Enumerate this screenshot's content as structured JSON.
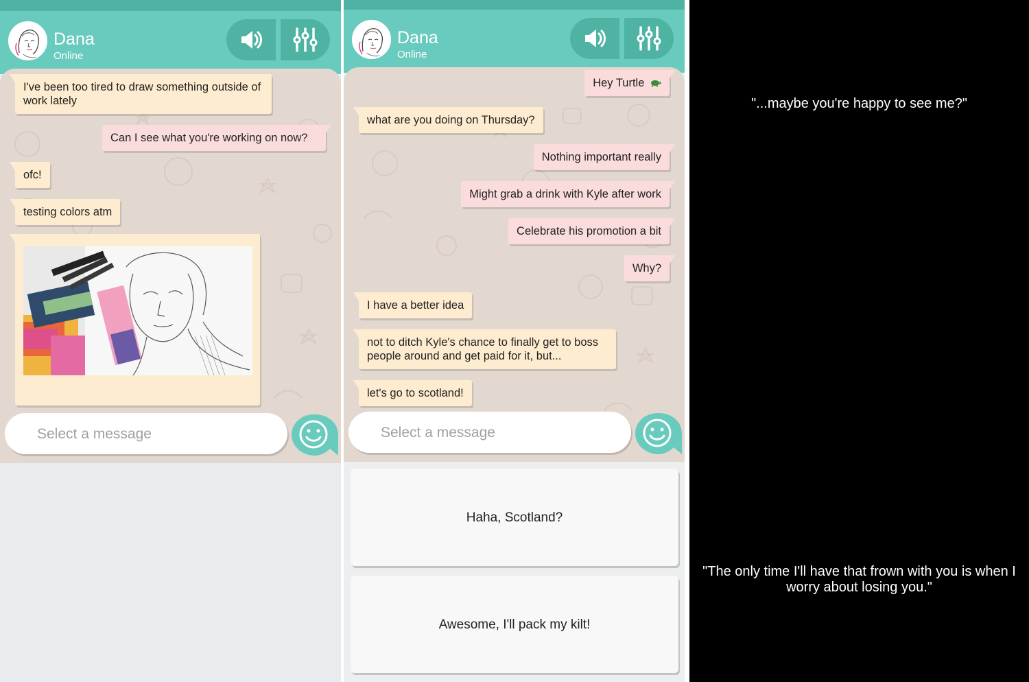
{
  "colors": {
    "header": "#69cbbd",
    "header_dark": "#4fb3a3",
    "chat_bg": "#e3d8d0",
    "incoming_bubble": "#fdecd0",
    "outgoing_bubble": "#fbdcdc",
    "choice_bg": "#f8f8f8",
    "narration_bg": "#000000"
  },
  "panel1": {
    "contact": {
      "name": "Dana",
      "status": "Online"
    },
    "icons": {
      "sound": "speaker-icon",
      "settings": "sliders-icon",
      "emoji": "smiley-icon"
    },
    "messages": [
      {
        "dir": "in",
        "text": "I've been too tired to draw something outside of work lately"
      },
      {
        "dir": "out",
        "text": "Can I see what you're working on now?"
      },
      {
        "dir": "in",
        "text": "ofc!"
      },
      {
        "dir": "in",
        "text": "testing colors atm"
      }
    ],
    "image_message": {
      "dir": "in",
      "content": "sketch-photo"
    },
    "input": {
      "placeholder": "Select a message"
    }
  },
  "panel2": {
    "contact": {
      "name": "Dana",
      "status": "Online"
    },
    "messages": [
      {
        "dir": "out",
        "text": "Hey Turtle",
        "emoji": "turtle-icon"
      },
      {
        "dir": "in",
        "text": "what are you doing on Thursday?"
      },
      {
        "dir": "out",
        "text": "Nothing important really"
      },
      {
        "dir": "out",
        "text": "Might grab a drink with Kyle after work"
      },
      {
        "dir": "out",
        "text": "Celebrate his promotion a bit"
      },
      {
        "dir": "out",
        "text": "Why?"
      },
      {
        "dir": "in",
        "text": "I have a better idea"
      },
      {
        "dir": "in",
        "text": "not to ditch Kyle's chance to finally get to boss people around and get paid for it, but..."
      },
      {
        "dir": "in",
        "text": "let's go to scotland!"
      }
    ],
    "input": {
      "placeholder": "Select a message"
    },
    "choices": [
      {
        "text": "Haha, Scotland?"
      },
      {
        "text": "Awesome, I'll pack my kilt!"
      }
    ]
  },
  "panel3": {
    "quote_top": "\"...maybe you're happy to see me?\"",
    "quote_bottom": "\"The only time I'll have that frown with you is when I worry about losing you.\""
  }
}
